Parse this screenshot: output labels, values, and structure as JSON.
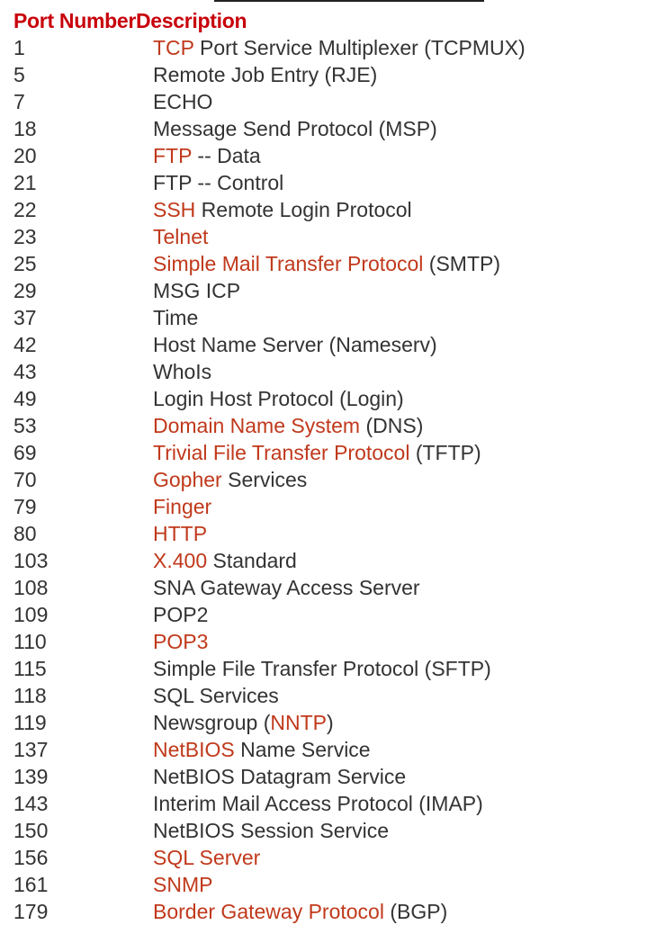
{
  "header": {
    "port_label": "Port Number",
    "desc_label": "Description"
  },
  "rows": [
    {
      "port": "1",
      "parts": [
        {
          "t": "TCP",
          "link": true
        },
        {
          "t": " Port Service Multiplexer (TCPMUX)"
        }
      ]
    },
    {
      "port": "5",
      "parts": [
        {
          "t": "Remote Job Entry (RJE)"
        }
      ]
    },
    {
      "port": "7",
      "parts": [
        {
          "t": "ECHO"
        }
      ]
    },
    {
      "port": "18",
      "parts": [
        {
          "t": "Message Send Protocol (MSP)"
        }
      ]
    },
    {
      "port": "20",
      "parts": [
        {
          "t": "FTP",
          "link": true
        },
        {
          "t": " -- Data"
        }
      ]
    },
    {
      "port": "21",
      "parts": [
        {
          "t": "FTP -- Control"
        }
      ]
    },
    {
      "port": "22",
      "parts": [
        {
          "t": "SSH",
          "link": true
        },
        {
          "t": " Remote Login Protocol"
        }
      ]
    },
    {
      "port": "23",
      "parts": [
        {
          "t": "Telnet",
          "link": true
        }
      ]
    },
    {
      "port": "25",
      "parts": [
        {
          "t": "Simple Mail Transfer Protocol",
          "link": true
        },
        {
          "t": " (SMTP)"
        }
      ]
    },
    {
      "port": "29",
      "parts": [
        {
          "t": "MSG ICP"
        }
      ]
    },
    {
      "port": "37",
      "parts": [
        {
          "t": "Time"
        }
      ]
    },
    {
      "port": "42",
      "parts": [
        {
          "t": "Host Name Server (Nameserv)"
        }
      ]
    },
    {
      "port": "43",
      "parts": [
        {
          "t": "WhoIs"
        }
      ]
    },
    {
      "port": "49",
      "parts": [
        {
          "t": "Login Host Protocol (Login)"
        }
      ]
    },
    {
      "port": "53",
      "parts": [
        {
          "t": "Domain Name System",
          "link": true
        },
        {
          "t": " (DNS)"
        }
      ]
    },
    {
      "port": "69",
      "parts": [
        {
          "t": "Trivial File Transfer Protocol",
          "link": true
        },
        {
          "t": " (TFTP)"
        }
      ]
    },
    {
      "port": "70",
      "parts": [
        {
          "t": "Gopher",
          "link": true
        },
        {
          "t": " Services"
        }
      ]
    },
    {
      "port": "79",
      "parts": [
        {
          "t": "Finger",
          "link": true
        }
      ]
    },
    {
      "port": "80",
      "parts": [
        {
          "t": "HTTP",
          "link": true
        }
      ]
    },
    {
      "port": "103",
      "parts": [
        {
          "t": "X.400",
          "link": true
        },
        {
          "t": " Standard"
        }
      ]
    },
    {
      "port": "108",
      "parts": [
        {
          "t": "SNA Gateway Access Server"
        }
      ]
    },
    {
      "port": "109",
      "parts": [
        {
          "t": "POP2"
        }
      ]
    },
    {
      "port": "110",
      "parts": [
        {
          "t": "POP3",
          "link": true
        }
      ]
    },
    {
      "port": "115",
      "parts": [
        {
          "t": "Simple File Transfer Protocol (SFTP)"
        }
      ]
    },
    {
      "port": "118",
      "parts": [
        {
          "t": "SQL Services"
        }
      ]
    },
    {
      "port": "119",
      "parts": [
        {
          "t": "Newsgroup ("
        },
        {
          "t": "NNTP",
          "link": true
        },
        {
          "t": ")"
        }
      ]
    },
    {
      "port": "137",
      "parts": [
        {
          "t": "NetBIOS",
          "link": true
        },
        {
          "t": " Name Service"
        }
      ]
    },
    {
      "port": "139",
      "parts": [
        {
          "t": "NetBIOS Datagram Service"
        }
      ]
    },
    {
      "port": "143",
      "parts": [
        {
          "t": "Interim Mail Access Protocol (IMAP)"
        }
      ]
    },
    {
      "port": "150",
      "parts": [
        {
          "t": "NetBIOS Session Service"
        }
      ]
    },
    {
      "port": "156",
      "parts": [
        {
          "t": "SQL Server",
          "link": true
        }
      ]
    },
    {
      "port": "161",
      "parts": [
        {
          "t": "SNMP",
          "link": true
        }
      ]
    },
    {
      "port": "179",
      "parts": [
        {
          "t": "Border Gateway Protocol",
          "link": true
        },
        {
          "t": " (BGP)"
        }
      ]
    }
  ],
  "colors": {
    "header": "#c8000a",
    "link": "#c0391b",
    "text": "#333333"
  }
}
